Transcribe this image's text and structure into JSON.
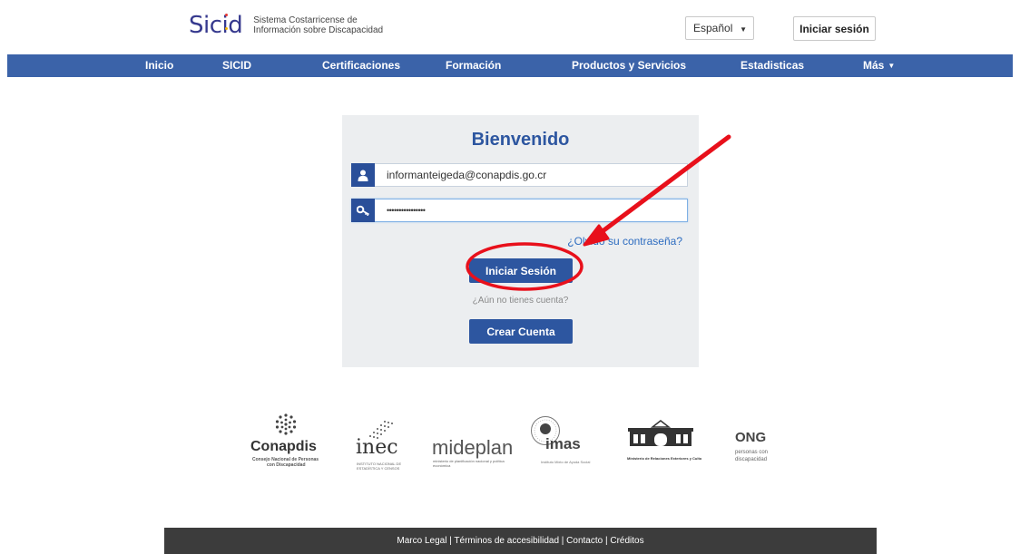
{
  "header": {
    "logo_text": "Sicid",
    "logo_tagline_1": "Sistema Costarricense de",
    "logo_tagline_2": "Información sobre Discapacidad",
    "language": "Español",
    "login_label": "Iniciar sesión"
  },
  "nav": {
    "items": [
      "Inicio",
      "SICID",
      "Certificaciones",
      "Formación",
      "Productos y Servicios",
      "Estadisticas",
      "Más"
    ]
  },
  "login": {
    "title": "Bienvenido",
    "email_value": "informanteigeda@conapdis.go.cr",
    "password_value": "••••••••••••••••",
    "forgot_label": "¿Olvidó su contraseña?",
    "submit_label": "Iniciar Sesión",
    "no_account_label": "¿Aún no tienes cuenta?",
    "create_label": "Crear Cuenta"
  },
  "partners": {
    "conapdis_name": "Conapdis",
    "conapdis_sub_1": "Consejo Nacional de Personas",
    "conapdis_sub_2": "con Discapacidad",
    "inec_name": "inec",
    "inec_sub_1": "INSTITUTO NACIONAL DE",
    "inec_sub_2": "ESTADÍSTICA Y CENSOS",
    "mideplan_name": "mideplan",
    "mideplan_sub_1": "ministerio de planificación nacional y política",
    "mideplan_sub_2": "económica",
    "imas_name": "imas",
    "imas_sub": "Instituto Mixto de Ayuda Social",
    "mre_sub": "Ministerio de Relaciones Exteriores y Culto",
    "ong_name": "ONG",
    "ong_sub_1": "personas con",
    "ong_sub_2": "discapacidad"
  },
  "footer": {
    "links_text": "Marco Legal | Términos de accesibilidad | Contacto | Créditos"
  },
  "icons": {
    "email": "user-icon",
    "password": "key-icon",
    "language_caret": "caret-down-icon",
    "more_caret": "caret-down-icon"
  },
  "colors": {
    "brand_blue": "#2d56a0",
    "nav_blue": "#3b63a9",
    "panel_bg": "#eceef0",
    "footer_bg": "#3c3c3c",
    "annotation_red": "#e8101b"
  }
}
